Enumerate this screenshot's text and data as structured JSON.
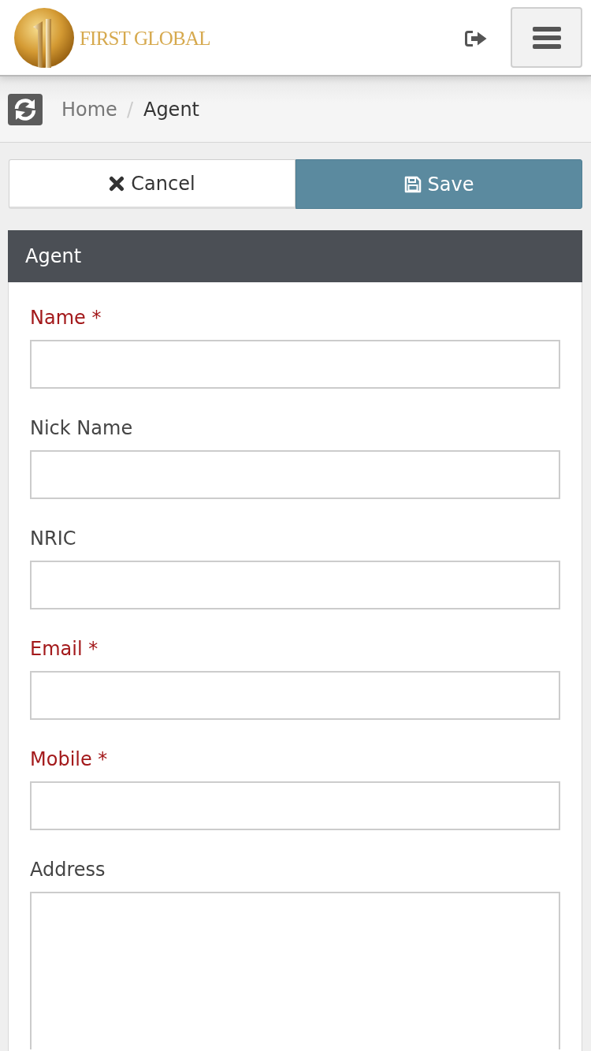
{
  "header": {
    "logo_text": "FIRST GLOBAL"
  },
  "breadcrumb": {
    "separator": "/",
    "items": [
      {
        "label": "Home",
        "active": false
      },
      {
        "label": "Agent",
        "active": true
      }
    ]
  },
  "actions": [
    {
      "kind": "cancel",
      "label": "Cancel"
    },
    {
      "kind": "save",
      "label": "Save"
    }
  ],
  "panel": {
    "title": "Agent",
    "fields": [
      {
        "kind": "text",
        "label": "Name *",
        "required": true
      },
      {
        "kind": "text",
        "label": "Nick Name",
        "required": false
      },
      {
        "kind": "text",
        "label": "NRIC",
        "required": false
      },
      {
        "kind": "text",
        "label": "Email *",
        "required": true
      },
      {
        "kind": "text",
        "label": "Mobile *",
        "required": true
      },
      {
        "kind": "textarea",
        "label": "Address",
        "required": false
      }
    ]
  }
}
